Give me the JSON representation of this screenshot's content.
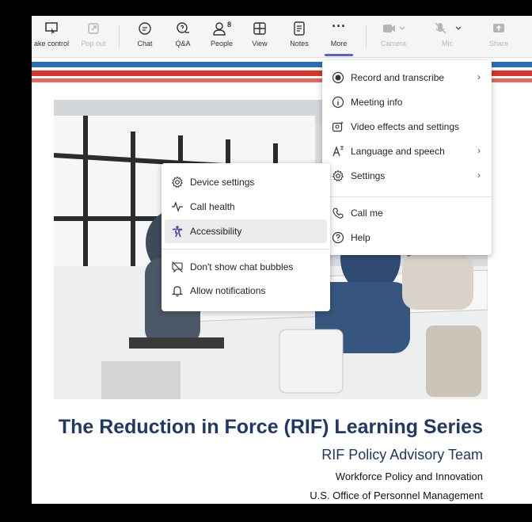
{
  "toolbar": {
    "take_control": "ake control",
    "pop_out": "Pop out",
    "chat": "Chat",
    "qa": "Q&A",
    "people": "People",
    "people_count": "8",
    "view": "View",
    "notes": "Notes",
    "more": "More",
    "camera": "Camera",
    "mic": "Mic",
    "share": "Share"
  },
  "more_menu": {
    "items": [
      {
        "label": "Record and transcribe",
        "icon": "record-icon",
        "submenu": true
      },
      {
        "label": "Meeting info",
        "icon": "info-icon",
        "submenu": false
      },
      {
        "label": "Video effects and settings",
        "icon": "video-effects-icon",
        "submenu": false
      },
      {
        "label": "Language and speech",
        "icon": "language-icon",
        "submenu": true
      },
      {
        "label": "Settings",
        "icon": "gear-icon",
        "submenu": true
      },
      {
        "label": "Call me",
        "icon": "phone-icon",
        "submenu": false
      },
      {
        "label": "Help",
        "icon": "help-icon",
        "submenu": false
      }
    ]
  },
  "settings_submenu": {
    "items": [
      {
        "label": "Device settings",
        "icon": "device-settings-icon"
      },
      {
        "label": "Call health",
        "icon": "call-health-icon"
      },
      {
        "label": "Accessibility",
        "icon": "accessibility-icon",
        "highlighted": true
      },
      {
        "label": "Don't show chat bubbles",
        "icon": "chat-bubble-off-icon"
      },
      {
        "label": "Allow notifications",
        "icon": "bell-icon"
      }
    ]
  },
  "slide": {
    "title": "The Reduction in Force (RIF) Learning Series",
    "subtitle": "RIF Policy Advisory Team",
    "line2": "Workforce Policy and Innovation",
    "line3": "U.S. Office of Personnel Management"
  },
  "colors": {
    "accent": "#5b5fc7",
    "title_navy": "#1f3864",
    "stripe_red": "#d9342b",
    "stripe_blue": "#2a6ebb"
  }
}
